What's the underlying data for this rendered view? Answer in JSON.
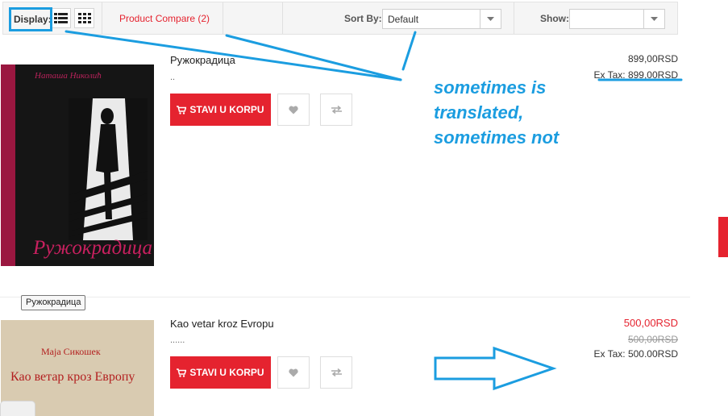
{
  "toolbar": {
    "display_label": "Display:",
    "compare_link": "Product Compare (2)",
    "sort_label": "Sort By:",
    "sort_value": "Default",
    "show_label": "Show:",
    "show_value": ""
  },
  "products": [
    {
      "title": "Ружокрадица",
      "desc": "..",
      "cover_author": "Наташа Николић",
      "cover_title": "Ружокрадица",
      "cart_label": "STAVI U KORPU",
      "price": "899,00RSD",
      "ex_tax": "Ex Tax: 899,00RSD"
    },
    {
      "title": "Kao vetar kroz Evropu",
      "desc": "......",
      "cover_author": "Маја Сикошек",
      "cover_title": "Као ветар кроз Европу",
      "cart_label": "STAVI U KORPU",
      "price_new": "500,00RSD",
      "price_old": "500,00RSD",
      "ex_tax": "Ex Tax: 500,00RSD"
    }
  ],
  "tooltip": "Ружокрадица",
  "annotation": {
    "line1": "sometimes is",
    "line2": "translated,",
    "line3": "sometimes not",
    "color": "#1b9de0"
  },
  "colors": {
    "accent_red": "#e5232f",
    "annotation_blue": "#1b9de0"
  },
  "icons": [
    "list-view-icon",
    "grid-view-icon",
    "cart-icon",
    "heart-icon",
    "compare-icon",
    "caret-down-icon"
  ]
}
